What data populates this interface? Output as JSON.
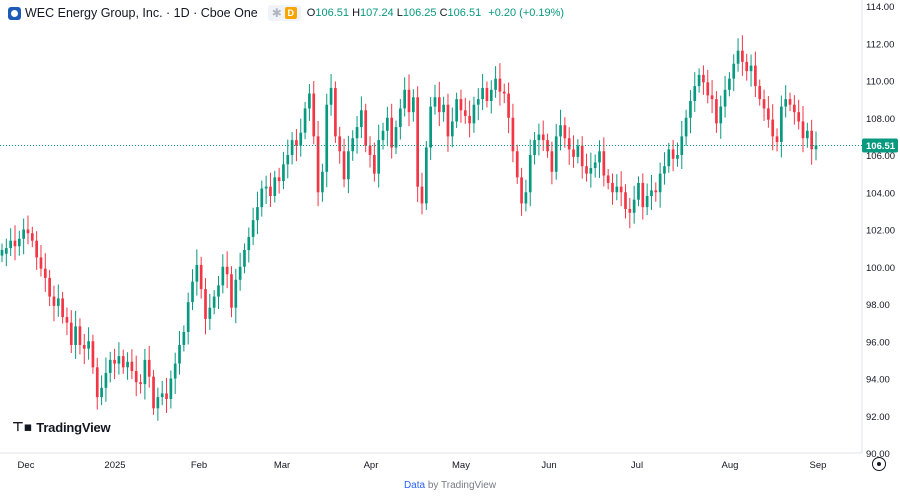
{
  "header": {
    "title": "WEC Energy Group, Inc. · 1D · Cboe One",
    "badge_symbol": "✱",
    "badge_delay": "D",
    "open_label": "O",
    "open_value": "106.51",
    "high_label": "H",
    "high_value": "107.24",
    "low_label": "L",
    "low_value": "106.25",
    "close_label": "C",
    "close_value": "106.51",
    "change": "+0.20 (+0.19%)"
  },
  "logo": {
    "text": "TradingView",
    "mark": "⊤▪"
  },
  "footer": {
    "link": "Data",
    "rest": " by TradingView"
  },
  "colors": {
    "up": "#089981",
    "down": "#f23645",
    "last_price_line": "#089981"
  },
  "chart_data": {
    "type": "candlestick",
    "ylim": [
      90,
      114
    ],
    "y_ticks": [
      "114.00",
      "112.00",
      "110.00",
      "108.00",
      "106.00",
      "104.00",
      "102.00",
      "100.00",
      "98.00",
      "96.00",
      "94.00",
      "92.00",
      "90.00"
    ],
    "x_ticks": [
      "Dec",
      "2025",
      "Feb",
      "Mar",
      "Apr",
      "May",
      "Jun",
      "Jul",
      "Aug",
      "Sep"
    ],
    "last_price": 106.51,
    "last_price_label": "106.51",
    "closes": [
      100.9,
      101.0,
      101.4,
      101.1,
      101.5,
      102.0,
      101.8,
      101.4,
      100.5,
      99.9,
      99.4,
      98.4,
      97.9,
      98.3,
      97.3,
      97.0,
      95.8,
      96.8,
      95.8,
      95.6,
      96.0,
      94.6,
      93.0,
      93.5,
      94.3,
      95.0,
      94.8,
      95.2,
      94.6,
      94.9,
      94.4,
      93.8,
      93.7,
      95.0,
      94.1,
      92.4,
      93.0,
      93.2,
      92.9,
      94.0,
      94.8,
      95.8,
      96.5,
      98.1,
      99.2,
      100.1,
      98.8,
      97.2,
      97.8,
      98.4,
      99.0,
      100.0,
      99.6,
      97.8,
      99.3,
      100.0,
      100.9,
      101.6,
      102.5,
      103.2,
      104.2,
      104.3,
      103.8,
      104.8,
      104.6,
      105.5,
      106.0,
      106.8,
      106.5,
      107.2,
      108.5,
      109.3,
      107.0,
      104.0,
      105.1,
      108.7,
      109.6,
      107.0,
      106.2,
      104.7,
      106.2,
      106.9,
      107.5,
      108.4,
      106.5,
      106.0,
      105.0,
      106.8,
      107.3,
      108.0,
      106.4,
      107.5,
      108.5,
      109.5,
      108.3,
      109.1,
      104.3,
      103.4,
      106.4,
      108.6,
      109.1,
      108.3,
      108.7,
      107.0,
      107.8,
      109.0,
      108.4,
      108.1,
      107.7,
      108.7,
      109.0,
      109.6,
      108.9,
      109.5,
      110.1,
      109.4,
      109.3,
      108.0,
      106.2,
      104.8,
      103.4,
      104.0,
      106.0,
      106.8,
      107.1,
      106.8,
      106.2,
      105.1,
      107.0,
      107.6,
      106.9,
      106.3,
      105.9,
      106.5,
      105.4,
      105.0,
      105.3,
      105.6,
      106.2,
      104.9,
      104.5,
      104.0,
      104.3,
      104.0,
      103.1,
      102.9,
      103.6,
      104.5,
      103.2,
      103.8,
      104.1,
      104.0,
      105.0,
      105.4,
      106.3,
      105.8,
      106.0,
      107.0,
      108.0,
      108.9,
      109.7,
      110.3,
      109.9,
      109.2,
      109.0,
      107.7,
      108.6,
      109.5,
      110.1,
      110.9,
      111.6,
      111.0,
      110.5,
      110.8,
      109.7,
      109.0,
      108.5,
      107.9,
      107.0,
      106.7,
      108.6,
      109.0,
      108.7,
      108.3,
      107.8,
      106.9,
      107.3,
      106.31,
      106.51
    ],
    "opens": [
      100.6,
      100.7,
      101.0,
      101.4,
      101.1,
      101.5,
      102.0,
      101.8,
      101.4,
      100.5,
      99.9,
      99.4,
      98.4,
      97.9,
      98.3,
      97.3,
      97.0,
      95.8,
      96.8,
      95.8,
      95.6,
      96.0,
      94.6,
      93.0,
      93.5,
      94.3,
      95.0,
      94.8,
      95.2,
      94.6,
      94.9,
      94.4,
      93.8,
      93.7,
      95.0,
      94.1,
      92.4,
      93.0,
      93.2,
      92.9,
      94.0,
      94.8,
      95.8,
      96.5,
      98.1,
      99.2,
      100.1,
      98.8,
      97.2,
      97.8,
      98.4,
      99.0,
      100.0,
      99.6,
      97.8,
      99.3,
      100.0,
      100.9,
      101.6,
      102.5,
      103.2,
      104.2,
      104.3,
      103.8,
      104.8,
      104.6,
      105.5,
      106.0,
      106.8,
      106.5,
      107.2,
      108.5,
      109.3,
      107.0,
      104.0,
      105.1,
      108.7,
      109.6,
      107.0,
      106.2,
      104.7,
      106.2,
      106.9,
      107.5,
      108.4,
      106.5,
      106.0,
      105.0,
      106.8,
      107.3,
      108.0,
      106.4,
      107.5,
      108.5,
      109.5,
      108.3,
      109.1,
      104.3,
      103.4,
      106.4,
      108.6,
      109.1,
      108.3,
      108.7,
      107.0,
      107.8,
      109.0,
      108.4,
      108.1,
      107.7,
      108.7,
      109.0,
      109.6,
      108.9,
      109.5,
      110.1,
      109.4,
      109.3,
      108.0,
      106.2,
      104.8,
      103.4,
      104.0,
      106.0,
      106.8,
      107.1,
      106.8,
      106.2,
      105.1,
      107.0,
      107.6,
      106.9,
      106.3,
      105.9,
      106.5,
      105.4,
      105.0,
      105.3,
      105.6,
      106.2,
      104.9,
      104.5,
      104.0,
      104.3,
      104.0,
      103.1,
      102.9,
      103.6,
      104.5,
      103.2,
      103.8,
      104.1,
      104.0,
      105.0,
      105.4,
      106.3,
      105.8,
      106.0,
      107.0,
      108.0,
      108.9,
      109.7,
      110.3,
      109.9,
      109.2,
      109.0,
      107.7,
      108.6,
      109.5,
      110.1,
      110.9,
      111.6,
      111.0,
      110.5,
      110.8,
      109.7,
      109.0,
      108.5,
      107.9,
      107.0,
      106.7,
      108.6,
      109.0,
      108.7,
      108.3,
      107.8,
      106.9,
      107.3,
      106.31
    ]
  }
}
